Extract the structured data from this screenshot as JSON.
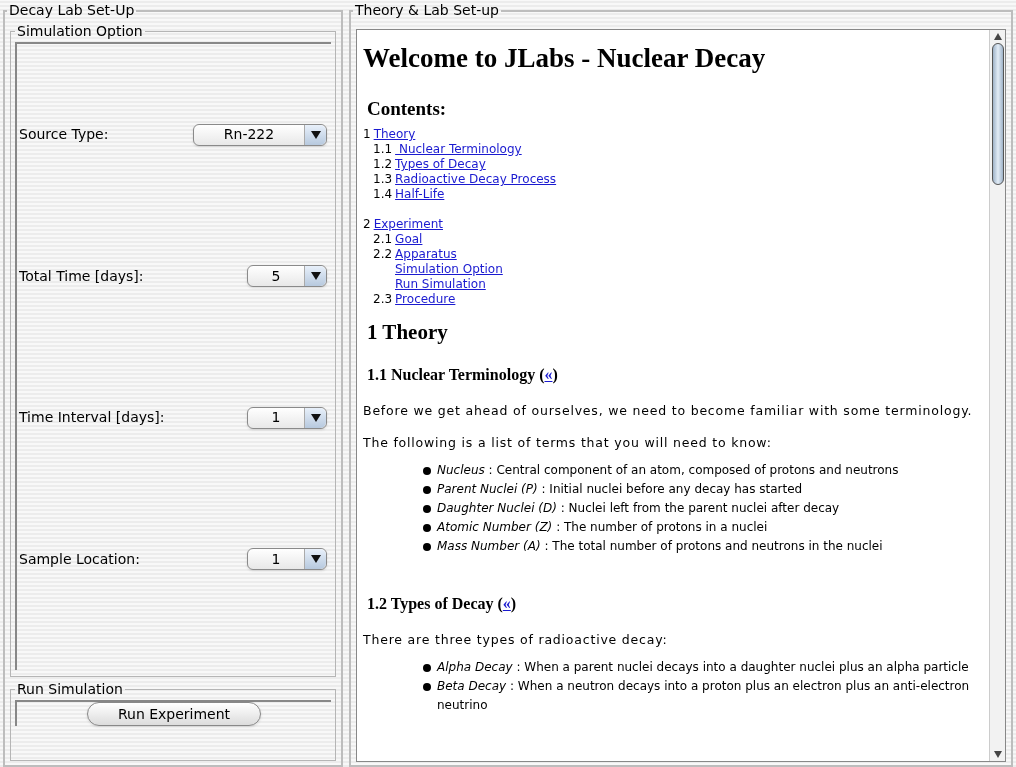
{
  "left_panel": {
    "title": "Decay Lab Set-Up",
    "simulation_option": {
      "title": "Simulation Option",
      "fields": [
        {
          "label": "Source Type:",
          "value": "Rn-222"
        },
        {
          "label": "Total Time [days]:",
          "value": "5"
        },
        {
          "label": "Time Interval [days]:",
          "value": "1"
        },
        {
          "label": "Sample Location:",
          "value": "1"
        }
      ]
    },
    "run_simulation": {
      "title": "Run Simulation",
      "button": "Run Experiment"
    }
  },
  "right_panel": {
    "title": "Theory & Lab Set-up",
    "document": {
      "title": "Welcome to JLabs - Nuclear Decay",
      "contents_title": "Contents:",
      "contents": [
        {
          "number": "1",
          "link": "Theory",
          "children": [
            {
              "number": "1.1",
              "link": " Nuclear Terminology"
            },
            {
              "number": "1.2",
              "link": "Types of Decay"
            },
            {
              "number": "1.3",
              "link": "Radioactive Decay Process"
            },
            {
              "number": "1.4",
              "link": "Half-Life"
            }
          ]
        },
        {
          "number": "2",
          "link": "Experiment",
          "children": [
            {
              "number": "2.1",
              "link": "Goal"
            },
            {
              "number": "2.2",
              "link": "Apparatus",
              "children": [
                {
                  "link": "Simulation Option"
                },
                {
                  "link": "Run Simulation"
                }
              ]
            },
            {
              "number": "2.3",
              "link": "Procedure"
            }
          ]
        }
      ],
      "section_title": "1 Theory",
      "subsections": [
        {
          "heading_before": "1.1 Nuclear Terminology (",
          "back_link": "«",
          "heading_after": ")",
          "paragraph": "Before we get ahead of ourselves, we need to become familiar with some terminology. The following is a list of terms that you will need to know:",
          "bullets": [
            {
              "term": "Nucleus",
              "text": ": Central component of an atom, composed of protons and neutrons"
            },
            {
              "term": "Parent Nuclei (P)",
              "text": ": Initial nuclei before any decay has started"
            },
            {
              "term": "Daughter Nuclei (D)",
              "text": ": Nuclei left from the parent nuclei after decay"
            },
            {
              "term": "Atomic Number (Z)",
              "text": ": The number of protons in a nuclei"
            },
            {
              "term": "Mass Number (A)",
              "text": ": The total number of protons and neutrons in the nuclei"
            }
          ]
        },
        {
          "heading_before": "1.2 Types of Decay (",
          "back_link": "«",
          "heading_after": ")",
          "paragraph": "There are three types of radioactive decay:",
          "bullets": [
            {
              "term": "Alpha Decay",
              "text": ": When a parent nuclei decays into a daughter nuclei plus an alpha particle"
            },
            {
              "term": "Beta Decay",
              "text": ": When a neutron decays into a proton plus an electron plus an anti-electron neutrino"
            }
          ]
        }
      ]
    }
  }
}
